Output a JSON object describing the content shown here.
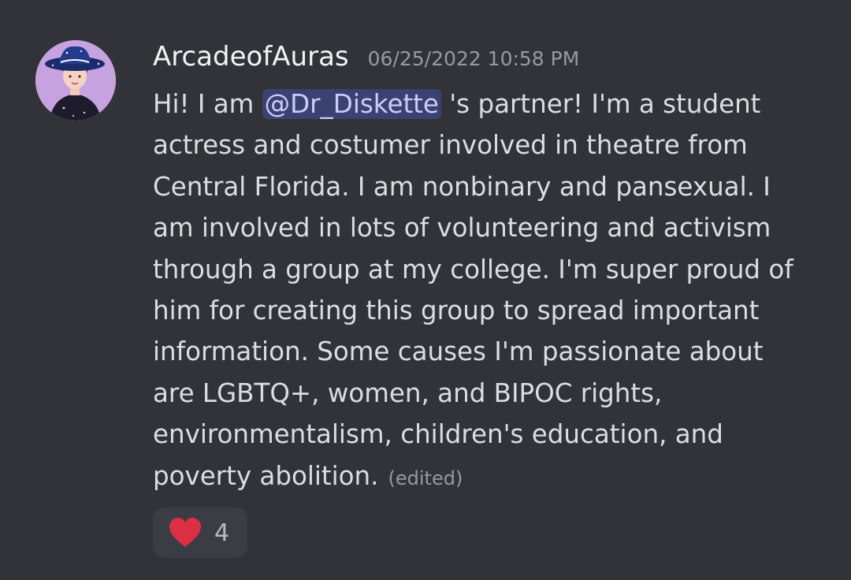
{
  "message": {
    "author": "ArcadeofAuras",
    "timestamp": "06/25/2022 10:58 PM",
    "content_lines": [
      {
        "before": "Hi! I am ",
        "mention": "@Dr_Diskette",
        "after": " 's partner! I'm a student"
      },
      "actress and costumer involved in theatre from",
      "Central Florida. I am nonbinary and pansexual. I",
      "am involved in lots of volunteering and activism",
      "through a group at my college. I'm super proud of",
      "him for creating this group to spread important",
      "information. Some causes I'm passionate about",
      "are LGBTQ+, women, and BIPOC rights,",
      "environmentalism, children's education, and",
      "poverty abolition."
    ],
    "edited_label": "(edited)",
    "reaction": {
      "emoji": "heart-icon",
      "count": "4",
      "color": "#dd2e44"
    },
    "colors": {
      "background": "#313338",
      "mention_bg": "#3c4270",
      "mention_text": "#c9cdfb"
    }
  }
}
